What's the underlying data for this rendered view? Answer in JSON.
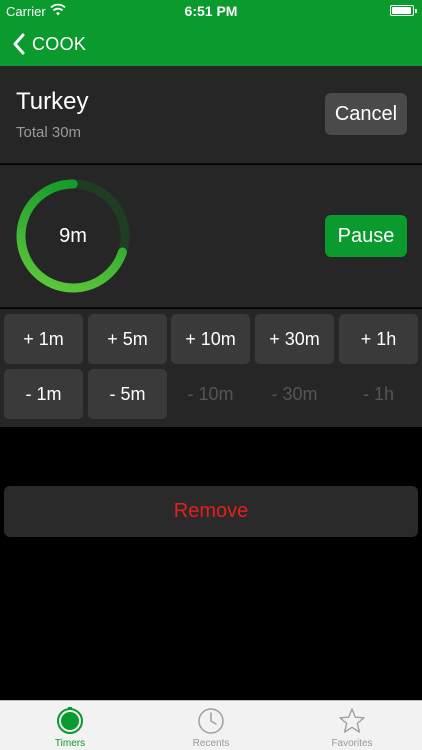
{
  "status_bar": {
    "carrier": "Carrier",
    "time": "6:51 PM",
    "battery_level": 0.95
  },
  "nav": {
    "back_label": "COOK"
  },
  "timer": {
    "name": "Turkey",
    "total": "Total 30m",
    "remaining": "9m",
    "progress_fraction": 0.7,
    "cancel_label": "Cancel",
    "pause_label": "Pause"
  },
  "adjust": {
    "add": [
      {
        "label": "+ 1m",
        "enabled": true
      },
      {
        "label": "+ 5m",
        "enabled": true
      },
      {
        "label": "+ 10m",
        "enabled": true
      },
      {
        "label": "+ 30m",
        "enabled": true
      },
      {
        "label": "+ 1h",
        "enabled": true
      }
    ],
    "subtract": [
      {
        "label": "- 1m",
        "enabled": true
      },
      {
        "label": "- 5m",
        "enabled": true
      },
      {
        "label": "- 10m",
        "enabled": false
      },
      {
        "label": "- 30m",
        "enabled": false
      },
      {
        "label": "- 1h",
        "enabled": false
      }
    ]
  },
  "remove_label": "Remove",
  "tabs": [
    {
      "label": "Timers",
      "icon": "timer-icon",
      "active": true
    },
    {
      "label": "Recents",
      "icon": "clock-icon",
      "active": false
    },
    {
      "label": "Favorites",
      "icon": "star-icon",
      "active": false
    }
  ],
  "colors": {
    "accent": "#0a9a2e",
    "ring_track": "#1e3d22",
    "destructive": "#e0201e"
  }
}
